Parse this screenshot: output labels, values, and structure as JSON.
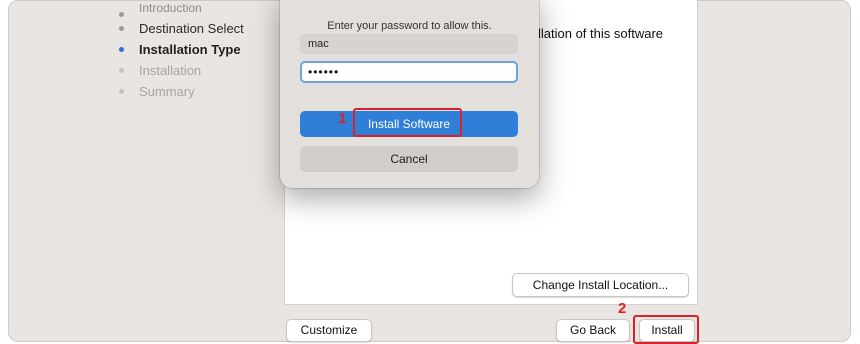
{
  "sidebar": {
    "items": [
      {
        "label": "Introduction",
        "state": "cut"
      },
      {
        "label": "Destination Select",
        "state": "done"
      },
      {
        "label": "Installation Type",
        "state": "active"
      },
      {
        "label": "Installation",
        "state": "pending"
      },
      {
        "label": "Summary",
        "state": "pending"
      }
    ]
  },
  "content": {
    "text": "llation of this software",
    "change_location_label": "Change Install Location..."
  },
  "footer": {
    "customize_label": "Customize",
    "go_back_label": "Go Back",
    "install_label": "Install"
  },
  "dialog": {
    "message": "Enter your password to allow this.",
    "username": "mac",
    "password_masked": "••••••",
    "install_software_label": "Install Software",
    "cancel_label": "Cancel"
  },
  "annotations": {
    "step1": "1",
    "step2": "2",
    "color": "#d6222b"
  },
  "colors": {
    "accent": "#2f7fd8",
    "active_dot": "#2f6fd6",
    "window_bg": "#e9e5e3"
  }
}
